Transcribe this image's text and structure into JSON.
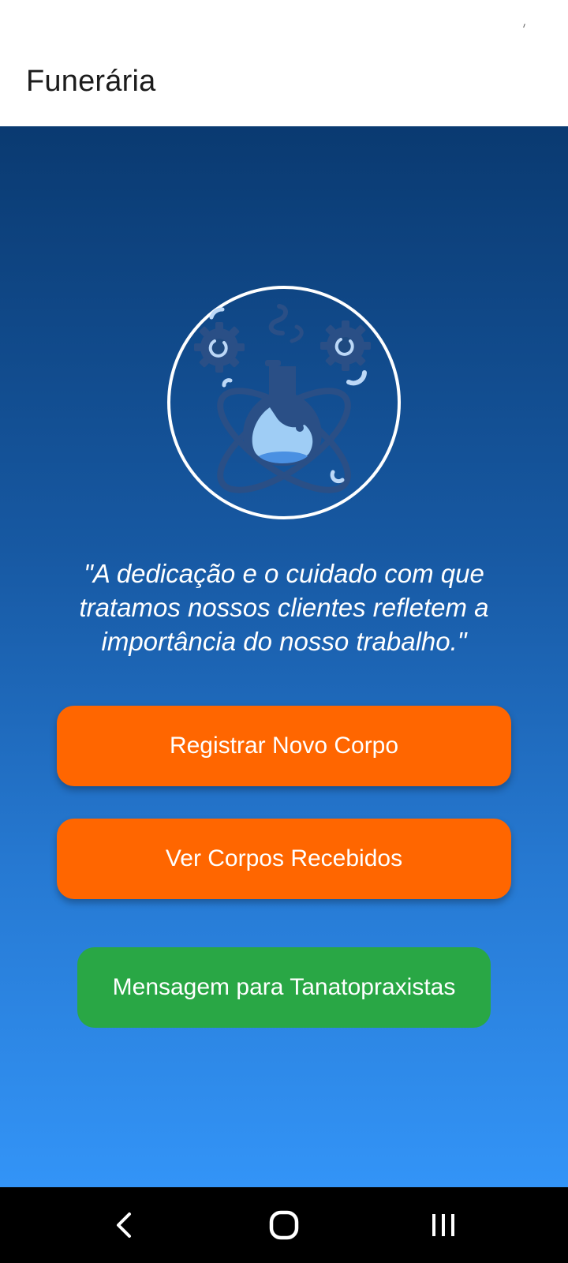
{
  "app_bar": {
    "title": "Funerária"
  },
  "hero": {
    "icon": "chemistry-flask-gears-icon",
    "quote": "\"A dedicação e o cuidado com que tratamos nossos clientes refletem a importância do nosso trabalho.\""
  },
  "actions": {
    "register_label": "Registrar Novo Corpo",
    "view_label": "Ver Corpos Recebidos",
    "message_label": "Mensagem para Tanatopraxistas"
  },
  "navigation": {
    "back_icon": "back-chevron-icon",
    "home_icon": "home-icon",
    "recents_icon": "recent-apps-icon"
  },
  "colors": {
    "primary_button": "#ff6600",
    "secondary_button": "#29a745",
    "gradient_top": "#0a3a71",
    "gradient_bottom": "#3394f7",
    "nav_bar": "#000000"
  }
}
